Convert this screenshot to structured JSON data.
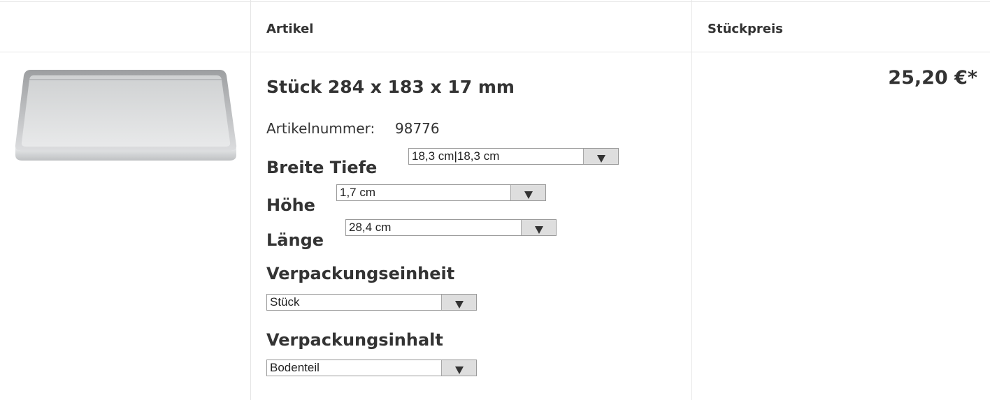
{
  "table": {
    "header_article": "Artikel",
    "header_unit_price": "Stückpreis"
  },
  "product": {
    "image_icon": "metal-tray-image",
    "title": "Stück 284 x 183 x 17 mm",
    "article_number_label": "Artikelnummer:",
    "article_number_value": "98776",
    "attributes": {
      "width_depth": {
        "label": "Breite Tiefe",
        "selected": "18,3 cm|18,3 cm"
      },
      "height": {
        "label": "Höhe",
        "selected": "1,7 cm"
      },
      "length": {
        "label": "Länge",
        "selected": "28,4 cm"
      },
      "packaging_unit": {
        "label": "Verpackungseinheit",
        "selected": "Stück"
      },
      "packaging_content": {
        "label": "Verpackungsinhalt",
        "selected": "Bodenteil"
      }
    },
    "price": "25,20 €*"
  },
  "colors": {
    "text": "#333333",
    "border": "#e6e6e6",
    "select_arrow_bg": "#dedede"
  }
}
